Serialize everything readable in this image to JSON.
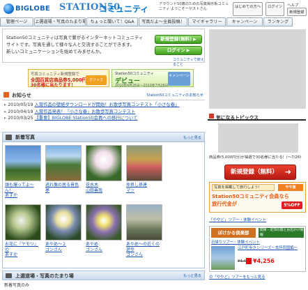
{
  "header": {
    "biglobe": "BIGLOBE",
    "station": "STATION50",
    "community": "コミュニティ",
    "tagline": "アラウンド50歳のための写真掲示板コミュニティ ようこそーゲストさん",
    "links": [
      "はじめての方へ",
      "ログイン",
      "ヘルプ",
      "新規登録"
    ]
  },
  "nav": [
    "管理ページ",
    "上選道場・写真のたまり場",
    "ちょっと聞いて！Q&A",
    "写真だよ～全員投稿！",
    "マイギャラリー",
    "キャンペーン",
    "ランキング"
  ],
  "intro": {
    "line1": "Station50コミュニティは写真で繋がるインターネットコミュニティ",
    "line2": "サイトです。写真を通して様々な人と交流することができます。",
    "line3": "新しいコミュニケーションを始めてみませんか。",
    "register": "新規登録(無料)",
    "login": "ログイン",
    "guide": "コミュニティで使えること"
  },
  "banners": {
    "b1_l1": "写真コミュニティ新規登録で",
    "b1_l2": "全国百貨店商品券5,000円分",
    "b1_l3": "30名様に当たります！",
    "b1_badge": "クリック",
    "b2_l1": "Station50コミュニティ",
    "b2_l2": "デビュー",
    "b2_l3": "2010年4月26日〜2010年7月26日",
    "b2_cam": "キャンペーン"
  },
  "news": {
    "title": "お知らせ",
    "more": "Station50コミュニティのお知らせ",
    "items": [
      {
        "date": "2010/05/19",
        "text": "入賞作品の壁紙ダウンロードが開始！お散歩写真コンテスト「小さな春」"
      },
      {
        "date": "2010/04/19",
        "text": "入賞作品発表！「小さな春」お散歩写真コンテスト"
      },
      {
        "date": "2010/03/25",
        "text": "【重要】BIGLOBE Station50会員への移行について"
      }
    ]
  },
  "photos": {
    "title": "新着写真",
    "more": "もっと見る",
    "items": [
      {
        "cap1": "頭も爆ってよ～ん！",
        "cap2": "あすか"
      },
      {
        "cap1": "逃れ像の居る景色",
        "cap2": "夢"
      },
      {
        "cap1": "花水木",
        "cap2": "山田善哉"
      },
      {
        "cap1": "仲良し孫達",
        "cap2": "マツ"
      },
      {
        "cap1": "",
        "cap2": ""
      },
      {
        "cap1": "お花に『ヤモリ』の",
        "cap2": "あすか"
      },
      {
        "cap1": "あやめ～２",
        "cap2": "ゴンさん"
      },
      {
        "cap1": "あやめ",
        "cap2": "ゴンさん"
      },
      {
        "cap1": "あやめ～の近くの遊歩",
        "cap2": "ゴンさん"
      },
      {
        "cap1": "",
        "cap2": ""
      }
    ]
  },
  "bottom": {
    "title": "上選道場・写真のたまり場",
    "more": "もっと見る",
    "row": "新着写真のみ"
  },
  "sidebar": {
    "topics_title": "気になるトピックス",
    "promo": "商品券(5,000円分)が抽選で30名様に当たる！(〜7/26)",
    "register": "新規登録（無料）",
    "travel_line1": "写真を掲載して旅行しよう！",
    "travel_logo": "やや旅",
    "travel_line2": "Station50コミュニティ会員なら",
    "travel_line3": "旅行代金が",
    "travel_off": "5%OFF",
    "yayoi": "「ややど」ツアー・体験イベント",
    "poke_head": "ぽけかる倶楽部",
    "poke_label": "関東・近郊の旅とお出かけ情報",
    "poke_reg": "日帰りツアー・体験イベント",
    "poke_title": "江戸町歩きシリーズ〜本所両国編〜",
    "poke_orig": "¥4,480",
    "poke_price": "¥4,256",
    "side_bottom": "の「ややど」ツアーをもっと見る"
  }
}
